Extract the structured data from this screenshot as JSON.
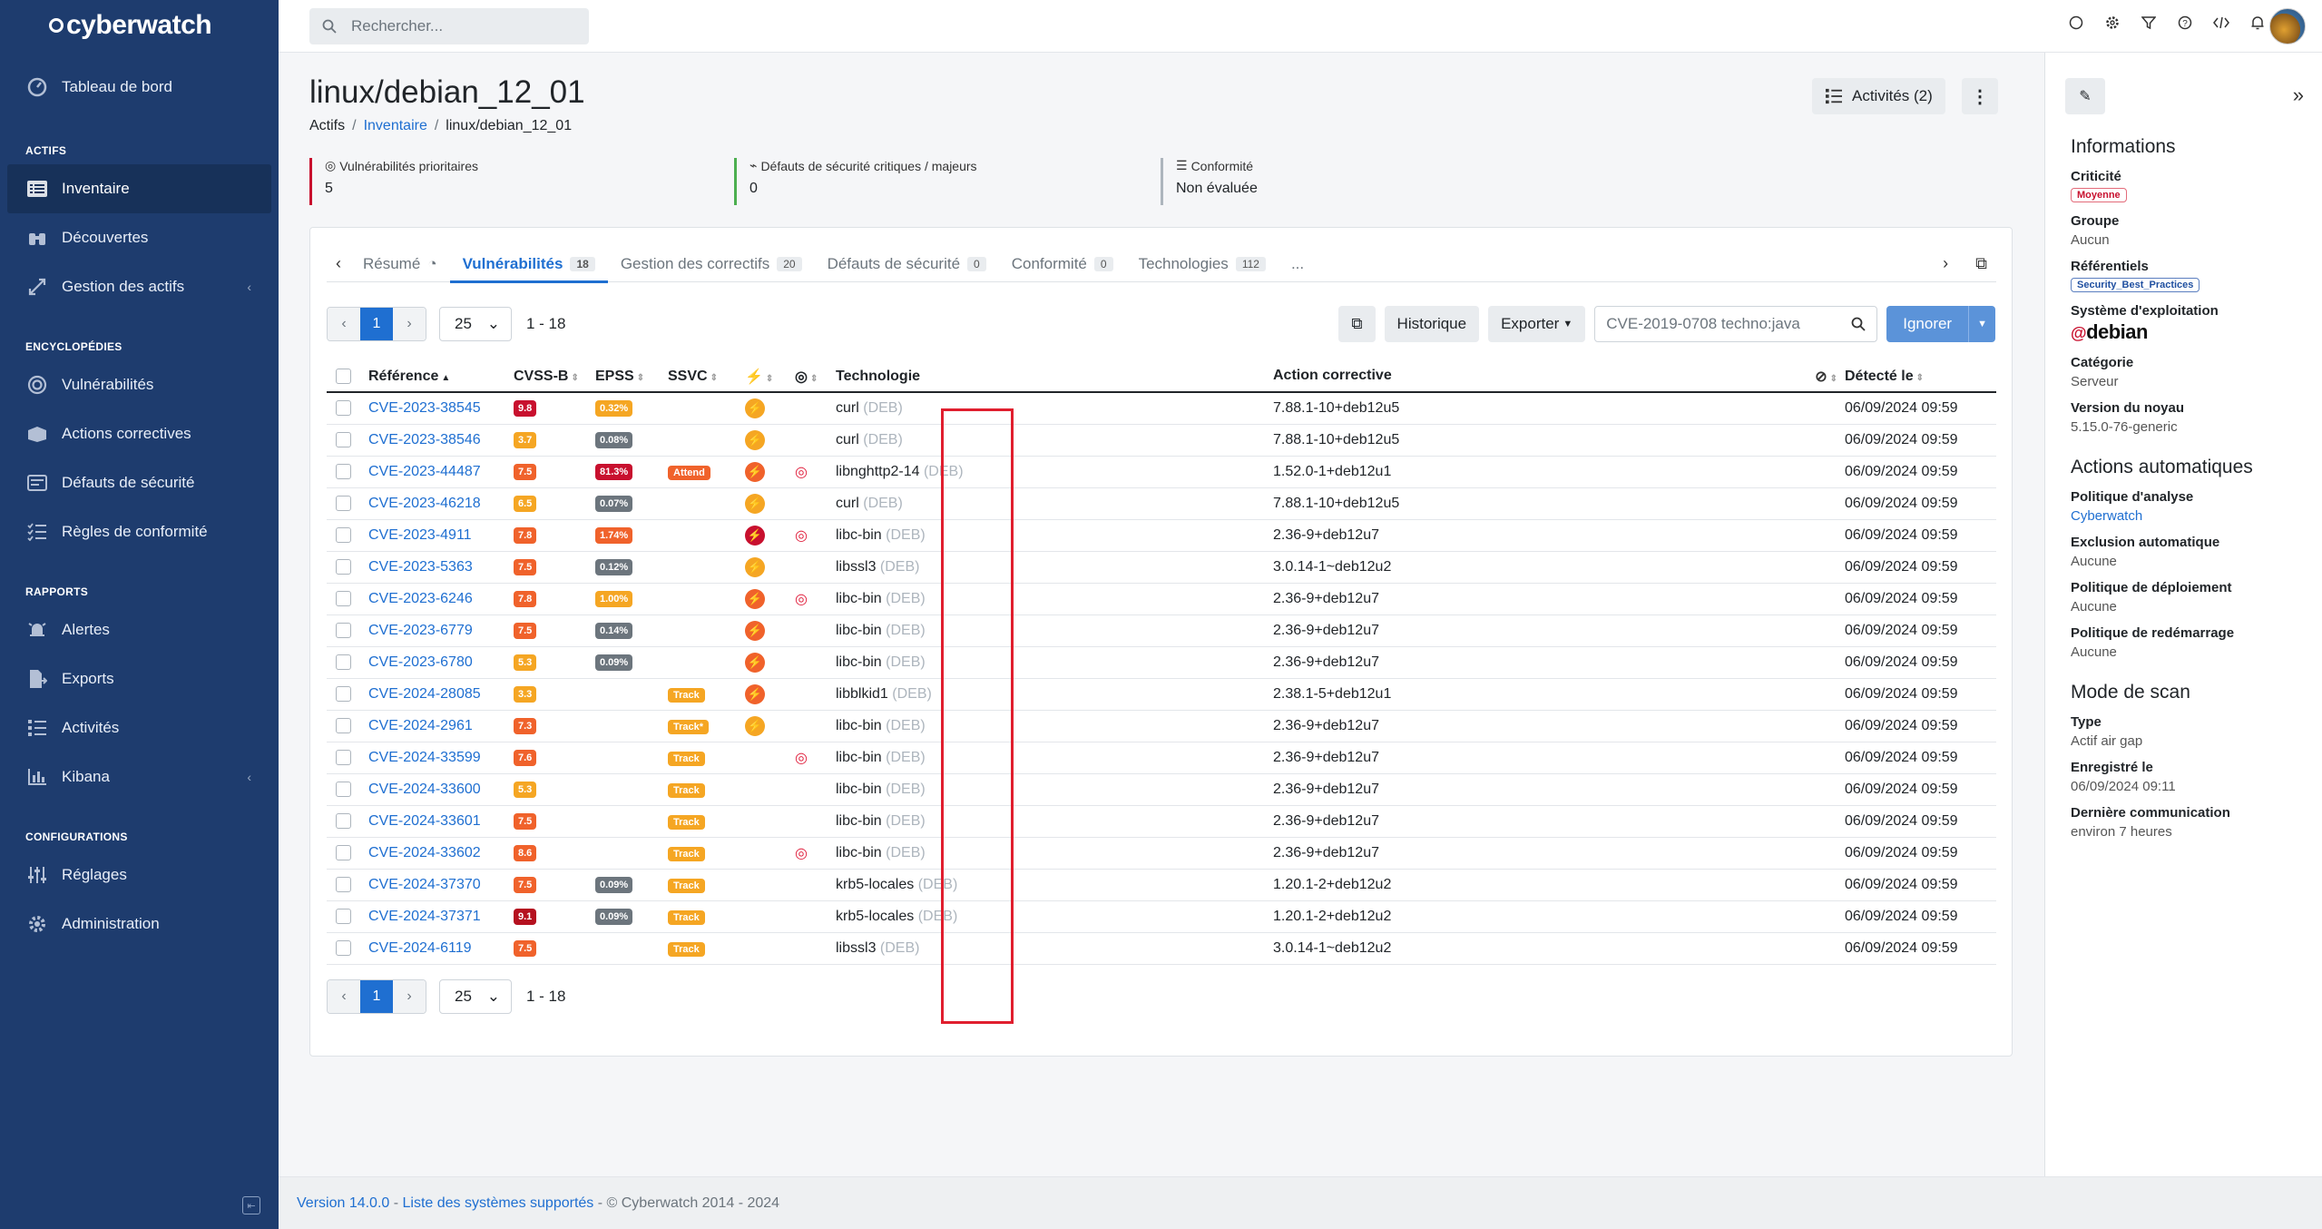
{
  "sidebar": {
    "logo": "cyberwatch",
    "dashboard": "Tableau de bord",
    "sec_actifs": "ACTIFS",
    "inventaire": "Inventaire",
    "decouvertes": "Découvertes",
    "gestion": "Gestion des actifs",
    "sec_ency": "ENCYCLOPÉDIES",
    "vulns": "Vulnérabilités",
    "actions": "Actions correctives",
    "defauts": "Défauts de sécurité",
    "regles": "Règles de conformité",
    "sec_rapports": "RAPPORTS",
    "alertes": "Alertes",
    "exports": "Exports",
    "activites": "Activités",
    "kibana": "Kibana",
    "sec_config": "CONFIGURATIONS",
    "reglages": "Réglages",
    "admin": "Administration"
  },
  "topbar": {
    "search_placeholder": "Rechercher..."
  },
  "page": {
    "title": "linux/debian_12_01",
    "bc1": "Actifs",
    "bc2": "Inventaire",
    "bc3": "linux/debian_12_01",
    "activities_btn": "Activités (2)"
  },
  "kpis": {
    "k1_label": "Vulnérabilités prioritaires",
    "k1_value": "5",
    "k1_color": "#c8102e",
    "k2_label": "Défauts de sécurité critiques / majeurs",
    "k2_value": "0",
    "k2_color": "#4caf50",
    "k3_label": "Conformité",
    "k3_value": "Non évaluée",
    "k3_color": "#adb5bd"
  },
  "tabs": {
    "resume": "Résumé",
    "vulns": "Vulnérabilités",
    "vulns_count": "18",
    "correctifs": "Gestion des correctifs",
    "correctifs_count": "20",
    "defauts": "Défauts de sécurité",
    "defauts_count": "0",
    "conformite": "Conformité",
    "conformite_count": "0",
    "technos": "Technologies",
    "technos_count": "112",
    "more": "..."
  },
  "controls": {
    "page": "1",
    "per_page": "25",
    "range": "1 - 18",
    "historique": "Historique",
    "exporter": "Exporter",
    "filter_placeholder": "CVE-2019-0708 techno:java",
    "ignorer": "Ignorer"
  },
  "table": {
    "headers": {
      "ref": "Référence",
      "cvss": "CVSS-B",
      "epss": "EPSS",
      "ssvc": "SSVC",
      "tech": "Technologie",
      "action": "Action corrective",
      "detected": "Détecté le"
    },
    "rows": [
      {
        "cve": "CVE-2023-38545",
        "cvss": "9.8",
        "cvss_c": "bd",
        "epss": "0.32%",
        "epss_c": "bo",
        "ssvc": "",
        "bolt": "o",
        "tgt": false,
        "tech": "curl",
        "pkg": "(DEB)",
        "fix": "7.88.1-10+deb12u5",
        "date": "06/09/2024 09:59"
      },
      {
        "cve": "CVE-2023-38546",
        "cvss": "3.7",
        "cvss_c": "bo",
        "epss": "0.08%",
        "epss_c": "bg",
        "ssvc": "",
        "bolt": "o",
        "tgt": false,
        "tech": "curl",
        "pkg": "(DEB)",
        "fix": "7.88.1-10+deb12u5",
        "date": "06/09/2024 09:59"
      },
      {
        "cve": "CVE-2023-44487",
        "cvss": "7.5",
        "cvss_c": "bor",
        "epss": "81.3%",
        "epss_c": "bd",
        "ssvc": "Attend",
        "bolt": "or",
        "tgt": true,
        "tech": "libnghttp2-14",
        "pkg": "(DEB)",
        "fix": "1.52.0-1+deb12u1",
        "date": "06/09/2024 09:59"
      },
      {
        "cve": "CVE-2023-46218",
        "cvss": "6.5",
        "cvss_c": "bo",
        "epss": "0.07%",
        "epss_c": "bg",
        "ssvc": "",
        "bolt": "o",
        "tgt": false,
        "tech": "curl",
        "pkg": "(DEB)",
        "fix": "7.88.1-10+deb12u5",
        "date": "06/09/2024 09:59"
      },
      {
        "cve": "CVE-2023-4911",
        "cvss": "7.8",
        "cvss_c": "bor",
        "epss": "1.74%",
        "epss_c": "bor",
        "ssvc": "",
        "bolt": "r",
        "tgt": true,
        "tech": "libc-bin",
        "pkg": "(DEB)",
        "fix": "2.36-9+deb12u7",
        "date": "06/09/2024 09:59"
      },
      {
        "cve": "CVE-2023-5363",
        "cvss": "7.5",
        "cvss_c": "bor",
        "epss": "0.12%",
        "epss_c": "bg",
        "ssvc": "",
        "bolt": "o",
        "tgt": false,
        "tech": "libssl3",
        "pkg": "(DEB)",
        "fix": "3.0.14-1~deb12u2",
        "date": "06/09/2024 09:59"
      },
      {
        "cve": "CVE-2023-6246",
        "cvss": "7.8",
        "cvss_c": "bor",
        "epss": "1.00%",
        "epss_c": "bo",
        "ssvc": "",
        "bolt": "or",
        "tgt": true,
        "tech": "libc-bin",
        "pkg": "(DEB)",
        "fix": "2.36-9+deb12u7",
        "date": "06/09/2024 09:59"
      },
      {
        "cve": "CVE-2023-6779",
        "cvss": "7.5",
        "cvss_c": "bor",
        "epss": "0.14%",
        "epss_c": "bg",
        "ssvc": "",
        "bolt": "or",
        "tgt": false,
        "tech": "libc-bin",
        "pkg": "(DEB)",
        "fix": "2.36-9+deb12u7",
        "date": "06/09/2024 09:59"
      },
      {
        "cve": "CVE-2023-6780",
        "cvss": "5.3",
        "cvss_c": "bo",
        "epss": "0.09%",
        "epss_c": "bg",
        "ssvc": "",
        "bolt": "or",
        "tgt": false,
        "tech": "libc-bin",
        "pkg": "(DEB)",
        "fix": "2.36-9+deb12u7",
        "date": "06/09/2024 09:59"
      },
      {
        "cve": "CVE-2024-28085",
        "cvss": "3.3",
        "cvss_c": "bo",
        "epss": "",
        "epss_c": "",
        "ssvc": "Track",
        "bolt": "or",
        "tgt": false,
        "tech": "libblkid1",
        "pkg": "(DEB)",
        "fix": "2.38.1-5+deb12u1",
        "date": "06/09/2024 09:59"
      },
      {
        "cve": "CVE-2024-2961",
        "cvss": "7.3",
        "cvss_c": "bor",
        "epss": "",
        "epss_c": "",
        "ssvc": "Track*",
        "bolt": "o",
        "tgt": false,
        "tech": "libc-bin",
        "pkg": "(DEB)",
        "fix": "2.36-9+deb12u7",
        "date": "06/09/2024 09:59"
      },
      {
        "cve": "CVE-2024-33599",
        "cvss": "7.6",
        "cvss_c": "bor",
        "epss": "",
        "epss_c": "",
        "ssvc": "Track",
        "bolt": "",
        "tgt": true,
        "tech": "libc-bin",
        "pkg": "(DEB)",
        "fix": "2.36-9+deb12u7",
        "date": "06/09/2024 09:59"
      },
      {
        "cve": "CVE-2024-33600",
        "cvss": "5.3",
        "cvss_c": "bo",
        "epss": "",
        "epss_c": "",
        "ssvc": "Track",
        "bolt": "",
        "tgt": false,
        "tech": "libc-bin",
        "pkg": "(DEB)",
        "fix": "2.36-9+deb12u7",
        "date": "06/09/2024 09:59"
      },
      {
        "cve": "CVE-2024-33601",
        "cvss": "7.5",
        "cvss_c": "bor",
        "epss": "",
        "epss_c": "",
        "ssvc": "Track",
        "bolt": "",
        "tgt": false,
        "tech": "libc-bin",
        "pkg": "(DEB)",
        "fix": "2.36-9+deb12u7",
        "date": "06/09/2024 09:59"
      },
      {
        "cve": "CVE-2024-33602",
        "cvss": "8.6",
        "cvss_c": "bor",
        "epss": "",
        "epss_c": "",
        "ssvc": "Track",
        "bolt": "",
        "tgt": true,
        "tech": "libc-bin",
        "pkg": "(DEB)",
        "fix": "2.36-9+deb12u7",
        "date": "06/09/2024 09:59"
      },
      {
        "cve": "CVE-2024-37370",
        "cvss": "7.5",
        "cvss_c": "bor",
        "epss": "0.09%",
        "epss_c": "bg",
        "ssvc": "Track",
        "bolt": "",
        "tgt": false,
        "tech": "krb5-locales",
        "pkg": "(DEB)",
        "fix": "1.20.1-2+deb12u2",
        "date": "06/09/2024 09:59"
      },
      {
        "cve": "CVE-2024-37371",
        "cvss": "9.1",
        "cvss_c": "br",
        "epss": "0.09%",
        "epss_c": "bg",
        "ssvc": "Track",
        "bolt": "",
        "tgt": false,
        "tech": "krb5-locales",
        "pkg": "(DEB)",
        "fix": "1.20.1-2+deb12u2",
        "date": "06/09/2024 09:59"
      },
      {
        "cve": "CVE-2024-6119",
        "cvss": "7.5",
        "cvss_c": "bor",
        "epss": "",
        "epss_c": "",
        "ssvc": "Track",
        "bolt": "",
        "tgt": false,
        "tech": "libssl3",
        "pkg": "(DEB)",
        "fix": "3.0.14-1~deb12u2",
        "date": "06/09/2024 09:59"
      }
    ]
  },
  "footer": {
    "version": "Version 14.0.0",
    "dash": " - ",
    "systems": "Liste des systèmes supportés",
    "copy": " - © Cyberwatch 2014 - 2024"
  },
  "right": {
    "info_title": "Informations",
    "criticite_l": "Criticité",
    "criticite_v": "Moyenne",
    "groupe_l": "Groupe",
    "groupe_v": "Aucun",
    "ref_l": "Référentiels",
    "ref_v": "Security_Best_Practices",
    "os_l": "Système d'exploitation",
    "os_v": "debian",
    "cat_l": "Catégorie",
    "cat_v": "Serveur",
    "kernel_l": "Version du noyau",
    "kernel_v": "5.15.0-76-generic",
    "auto_title": "Actions automatiques",
    "pol_l": "Politique d'analyse",
    "pol_v": "Cyberwatch",
    "excl_l": "Exclusion automatique",
    "excl_v": "Aucune",
    "dep_l": "Politique de déploiement",
    "dep_v": "Aucune",
    "reboot_l": "Politique de redémarrage",
    "reboot_v": "Aucune",
    "scan_title": "Mode de scan",
    "type_l": "Type",
    "type_v": "Actif air gap",
    "reg_l": "Enregistré le",
    "reg_v": "06/09/2024 09:11",
    "last_l": "Dernière communication",
    "last_v": "environ 7 heures"
  }
}
